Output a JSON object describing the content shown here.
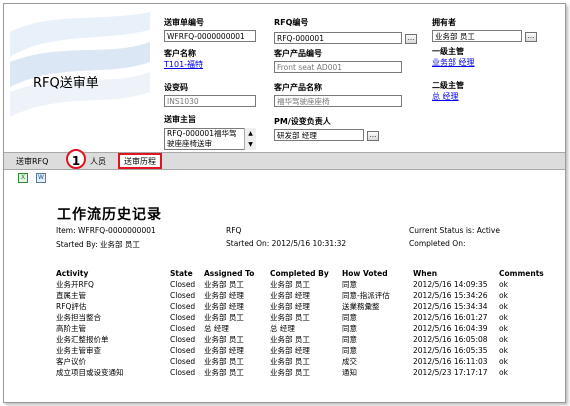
{
  "form": {
    "title": "RFQ送审单",
    "fields": {
      "submission_no": {
        "label": "送审单编号",
        "value": "WFRFQ-0000000001"
      },
      "customer_name": {
        "label": "客户名称",
        "value": "T101-福特"
      },
      "design_code": {
        "label": "设变码",
        "value": "INS1030"
      },
      "submission_purpose": {
        "label": "送审主旨",
        "value_line1": "RFQ-000001福华驾",
        "value_line2": "驶座座椅送审"
      },
      "rfq_no": {
        "label": "RFQ编号",
        "value": "RFQ-000001"
      },
      "customer_product_no": {
        "label": "客户产品编号",
        "value": "Front seat AD001"
      },
      "customer_product_name": {
        "label": "客户产品名称",
        "value": "福华驾驶座座椅"
      },
      "pm_owner": {
        "label": "PM/设变负责人",
        "value": "研发部 经理"
      },
      "owner": {
        "label": "拥有者",
        "value": "业务部 员工"
      },
      "level1_manager": {
        "label": "一级主管",
        "value": "业务部 经理"
      },
      "level2_manager": {
        "label": "二级主管",
        "value": "总 经理"
      }
    },
    "picker_label": "..."
  },
  "tabs": {
    "items": [
      "送审RFQ",
      "人员",
      "送审历程"
    ],
    "active_index": 2,
    "step_marker": "1"
  },
  "toolbar": {
    "excel_icon": "excel-icon",
    "word_icon": "word-icon"
  },
  "history": {
    "title": "工作流历史记录",
    "item_label": "Item: WFRFQ-0000000001",
    "rfq_label": "RFQ",
    "status_label": "Current Status is: Active",
    "started_by_label": "Started By: 业务部 员工",
    "started_on_label": "Started On: 2012/5/16 10:31:32",
    "completed_on_label": "Completed On:",
    "columns": [
      "Activity",
      "State",
      "Assigned To",
      "Completed By",
      "How Voted",
      "When",
      "Comments"
    ],
    "rows": [
      [
        "业务开RFQ",
        "Closed",
        "业务部 员工",
        "业务部 员工",
        "同意",
        "2012/5/16 14:09:35",
        "ok"
      ],
      [
        "直属主管",
        "Closed",
        "业务部 经理",
        "业务部 经理",
        "同意-指派评估",
        "2012/5/16 15:34:26",
        "ok"
      ],
      [
        "RFQ評估",
        "Closed",
        "业务部 经理",
        "业务部 经理",
        "送業務彙整",
        "2012/5/16 15:34:34",
        "ok"
      ],
      [
        "业务担当整合",
        "Closed",
        "业务部 员工",
        "业务部 员工",
        "同意",
        "2012/5/16 16:01:27",
        "ok"
      ],
      [
        "高阶主管",
        "Closed",
        "总 经理",
        "总 经理",
        "同意",
        "2012/5/16 16:04:39",
        "ok"
      ],
      [
        "业务汇整报价单",
        "Closed",
        "业务部 员工",
        "业务部 员工",
        "同意",
        "2012/5/16 16:05:08",
        "ok"
      ],
      [
        "业务主管审查",
        "Closed",
        "业务部 经理",
        "业务部 经理",
        "同意",
        "2012/5/16 16:05:35",
        "ok"
      ],
      [
        "客户议价",
        "Closed",
        "业务部 员工",
        "业务部 员工",
        "成交",
        "2012/5/16 16:11:03",
        "ok"
      ],
      [
        "成立项目或设变通知",
        "Closed",
        "业务部 员工",
        "业务部 员工",
        "通知",
        "2012/5/23 17:17:17",
        "ok"
      ]
    ]
  }
}
